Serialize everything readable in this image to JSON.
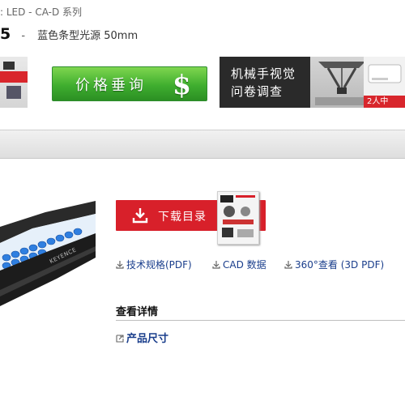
{
  "breadcrumb": ": LED - CA-D 系列",
  "title": {
    "code": "5",
    "separator": "-",
    "description": "蓝色条型光源 50mm"
  },
  "banners": {
    "price": {
      "label": "价格垂询",
      "symbol": "$"
    },
    "survey": {
      "line1": "机械手视觉",
      "line2": "问卷调查",
      "tag": "2人中"
    }
  },
  "product": {
    "brand": "KEYENCE"
  },
  "download": {
    "label": "下载目录"
  },
  "links": [
    {
      "label": "技术规格(PDF)"
    },
    {
      "label": "CAD 数据"
    },
    {
      "label": "360°查看 (3D PDF)"
    }
  ],
  "details": {
    "heading": "查看详情",
    "dimensions_label": "产品尺寸"
  },
  "colors": {
    "accent_red": "#d8202a",
    "link_blue": "#1a3e8c",
    "price_green": "#3fae2f"
  }
}
